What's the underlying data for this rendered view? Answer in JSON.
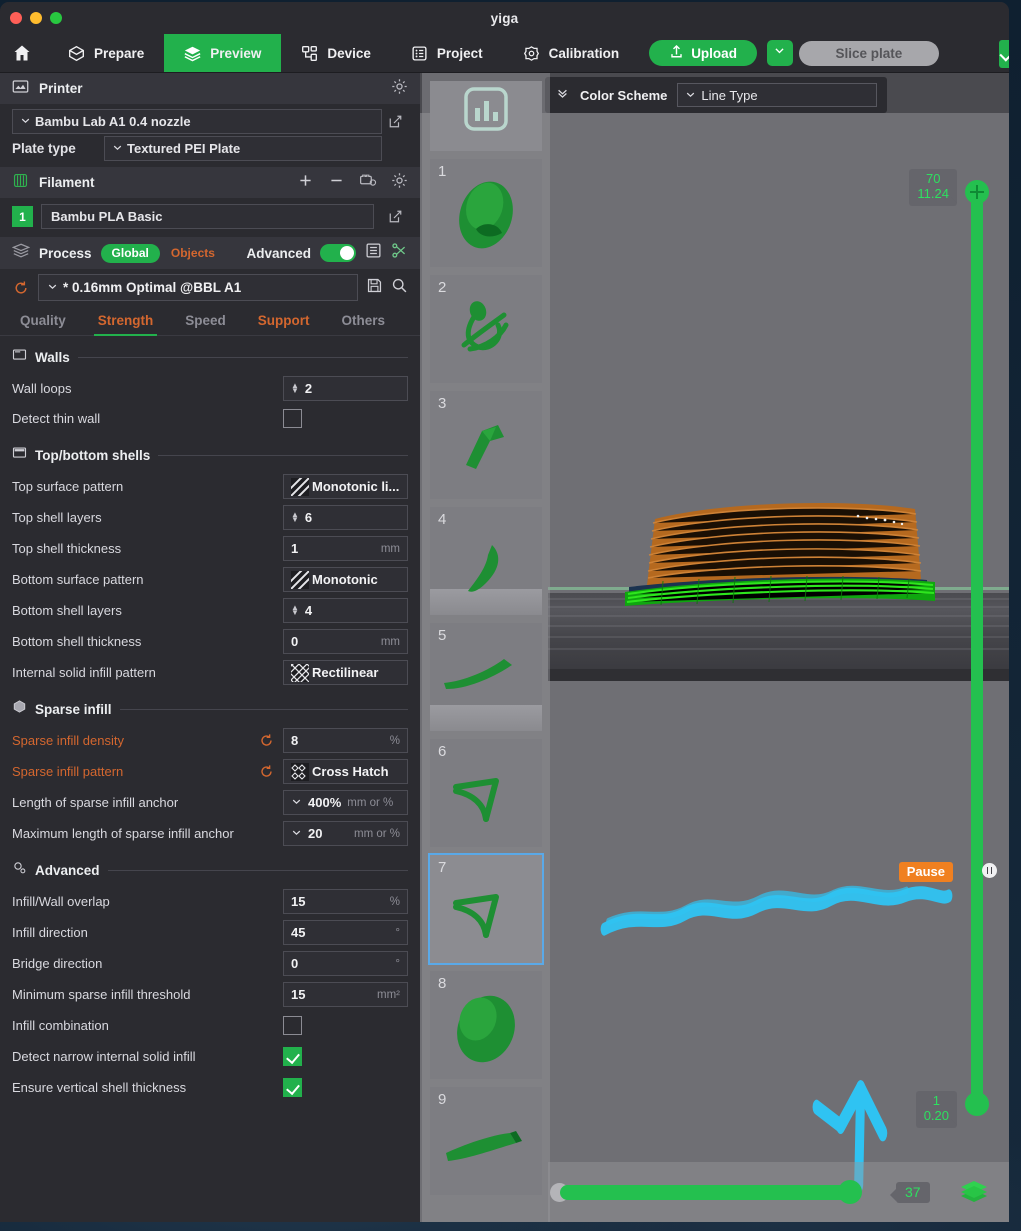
{
  "window": {
    "title": "yiga",
    "traffic_lights": [
      "close",
      "minimize",
      "maximize"
    ]
  },
  "toolbar": {
    "home_icon": "home-icon",
    "items": [
      {
        "label": "Prepare",
        "icon": "cube-icon",
        "active": false
      },
      {
        "label": "Preview",
        "icon": "layers-icon",
        "active": true
      },
      {
        "label": "Device",
        "icon": "device-icon",
        "active": false
      },
      {
        "label": "Project",
        "icon": "list-icon",
        "active": false
      },
      {
        "label": "Calibration",
        "icon": "target-icon",
        "active": false
      }
    ],
    "upload_label": "Upload",
    "upload_icon": "upload-icon",
    "caret_icon": "chevron-down-icon",
    "slice_plate_label": "Slice plate"
  },
  "printer": {
    "section_title": "Printer",
    "section_icon": "printer-icon",
    "gear_icon": "gear-icon",
    "preset": "Bambu Lab A1 0.4 nozzle",
    "edit_icon": "edit-icon",
    "plate_type_label": "Plate type",
    "plate_type_value": "Textured PEI Plate"
  },
  "filament": {
    "section_title": "Filament",
    "section_icon": "filament-icon",
    "add_icon": "plus-icon",
    "remove_icon": "minus-icon",
    "sync_icon": "ams-icon",
    "gear_icon": "gear-icon",
    "index": "1",
    "name": "Bambu PLA Basic",
    "edit_icon": "edit-icon"
  },
  "process": {
    "section_title": "Process",
    "section_icon": "process-icon",
    "scope_global": "Global",
    "scope_objects": "Objects",
    "advanced_label": "Advanced",
    "advanced_on": true,
    "list_icon": "list-view-icon",
    "compare_icon": "compare-icon",
    "reset_icon": "reset-icon",
    "preset": "* 0.16mm Optimal @BBL A1",
    "save_icon": "save-icon",
    "search_icon": "search-icon",
    "tabs": [
      {
        "label": "Quality",
        "state": "normal"
      },
      {
        "label": "Strength",
        "state": "active"
      },
      {
        "label": "Speed",
        "state": "normal"
      },
      {
        "label": "Support",
        "state": "modified"
      },
      {
        "label": "Others",
        "state": "normal"
      }
    ]
  },
  "groups": [
    {
      "title": "Walls",
      "icon": "walls-icon",
      "rows": [
        {
          "label": "Wall loops",
          "type": "spinner",
          "value": "2",
          "unit": "",
          "modified": false
        },
        {
          "label": "Detect thin wall",
          "type": "checkbox",
          "checked": false,
          "modified": false
        }
      ]
    },
    {
      "title": "Top/bottom shells",
      "icon": "shells-icon",
      "rows": [
        {
          "label": "Top surface pattern",
          "type": "pattern",
          "value": "Monotonic li...",
          "swatch": "diagonal-lines",
          "modified": false
        },
        {
          "label": "Top shell layers",
          "type": "spinner",
          "value": "6",
          "unit": "",
          "modified": false
        },
        {
          "label": "Top shell thickness",
          "type": "text",
          "value": "1",
          "unit": "mm",
          "modified": false
        },
        {
          "label": "Bottom surface pattern",
          "type": "pattern",
          "value": "Monotonic",
          "swatch": "diagonal-lines",
          "modified": false
        },
        {
          "label": "Bottom shell layers",
          "type": "spinner",
          "value": "4",
          "unit": "",
          "modified": false
        },
        {
          "label": "Bottom shell thickness",
          "type": "text",
          "value": "0",
          "unit": "mm",
          "modified": false
        },
        {
          "label": "Internal solid infill pattern",
          "type": "pattern",
          "value": "Rectilinear",
          "swatch": "grid",
          "modified": false
        }
      ]
    },
    {
      "title": "Sparse infill",
      "icon": "infill-icon",
      "rows": [
        {
          "label": "Sparse infill density",
          "type": "text",
          "value": "8",
          "unit": "%",
          "modified": true
        },
        {
          "label": "Sparse infill pattern",
          "type": "pattern",
          "value": "Cross Hatch",
          "swatch": "crosshatch",
          "modified": true
        },
        {
          "label": "Length of sparse infill anchor",
          "type": "dropdown",
          "value": "400%",
          "unit": "mm or %",
          "unit_tight": true,
          "modified": false
        },
        {
          "label": "Maximum length of sparse infill anchor",
          "type": "dropdown",
          "value": "20",
          "unit": "mm or %",
          "modified": false
        }
      ]
    },
    {
      "title": "Advanced",
      "icon": "advanced-icon",
      "rows": [
        {
          "label": "Infill/Wall overlap",
          "type": "text",
          "value": "15",
          "unit": "%",
          "modified": false
        },
        {
          "label": "Infill direction",
          "type": "text",
          "value": "45",
          "unit": "°",
          "modified": false
        },
        {
          "label": "Bridge direction",
          "type": "text",
          "value": "0",
          "unit": "°",
          "modified": false
        },
        {
          "label": "Minimum sparse infill threshold",
          "type": "text",
          "value": "15",
          "unit": "mm²",
          "modified": false
        },
        {
          "label": "Infill combination",
          "type": "checkbox",
          "checked": false,
          "modified": false
        },
        {
          "label": "Detect narrow internal solid infill",
          "type": "checkbox",
          "checked": true,
          "modified": false
        },
        {
          "label": "Ensure vertical shell thickness",
          "type": "checkbox",
          "checked": true,
          "modified": false
        }
      ]
    }
  ],
  "viewport": {
    "collapse_icon": "chevrons-up-icon",
    "color_scheme_label": "Color Scheme",
    "color_scheme_value": "Line Type",
    "color_scheme_caret": "chevron-down-icon",
    "thumbnails": [
      {
        "number": "1",
        "shape": "egg-open",
        "selected": false
      },
      {
        "number": "2",
        "shape": "loop-stem",
        "selected": false
      },
      {
        "number": "3",
        "shape": "wedge",
        "selected": false
      },
      {
        "number": "4",
        "shape": "hook",
        "selected": false
      },
      {
        "number": "5",
        "shape": "sliver",
        "selected": false
      },
      {
        "number": "6",
        "shape": "arrowhead",
        "selected": false
      },
      {
        "number": "7",
        "shape": "arrowhead",
        "selected": true
      },
      {
        "number": "8",
        "shape": "egg-solid",
        "selected": false
      },
      {
        "number": "9",
        "shape": "bullet",
        "selected": false
      }
    ],
    "vertical_slider": {
      "top_layer": "70",
      "top_height": "11.24",
      "bottom_layer": "1",
      "bottom_height": "0.20",
      "pause_label": "Pause",
      "pause_marker_icon": "pause-icon"
    },
    "horizontal_slider": {
      "value": "37"
    },
    "layers_icon": "layers-stack-icon"
  },
  "colors": {
    "accent_green": "#22b14c",
    "slider_green": "#24c04f",
    "modified_orange": "#d4672f",
    "pause_orange": "#f08020",
    "panel_bg": "#2b2b30",
    "section_bg": "#36363d",
    "viewport_bg": "#6f6f74",
    "select_blue": "#5aa9e8",
    "annotation_cyan": "#29c0f0",
    "infill_green": "#1ec81e",
    "top_surface_orange": "#c8712a"
  }
}
